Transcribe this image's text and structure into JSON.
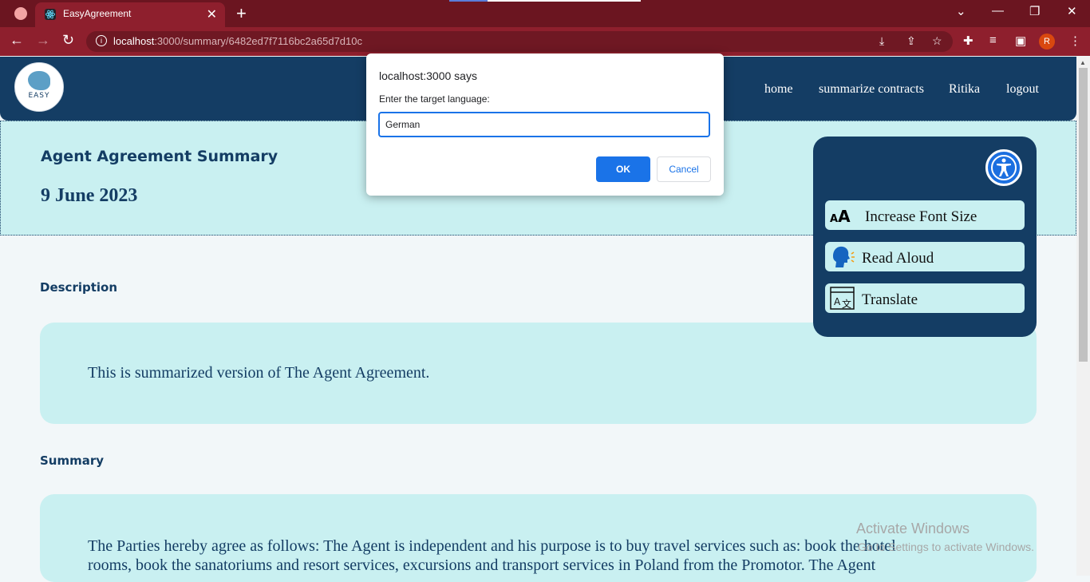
{
  "browser": {
    "tab_title": "EasyAgreement",
    "tab_close": "✕",
    "new_tab": "+",
    "url_host": "localhost",
    "url_rest": ":3000/summary/6482ed7f7116bc2a65d7d10c",
    "profile_initial": "R",
    "window_controls": [
      "⌄",
      "—",
      "❐",
      "✕"
    ]
  },
  "site": {
    "logo_text": "EASY",
    "nav": [
      "home",
      "summarize contracts",
      "Ritika",
      "logout"
    ]
  },
  "banner": {
    "title": "Agent Agreement Summary",
    "date": "9 June 2023"
  },
  "description": {
    "label": "Description",
    "text": "This is summarized version of The Agent Agreement."
  },
  "summary": {
    "label": "Summary",
    "line1": "The Parties hereby agree as follows: The Agent is independent and his purpose is to buy travel services such as: book the hotel",
    "line2": "rooms, book the sanatoriums and resort services, excursions and transport services in Poland from the Promotor. The Agent"
  },
  "accessibility": {
    "icon": "accessibility-icon",
    "buttons": [
      {
        "label": "Increase Font Size",
        "icon": "font-size-icon"
      },
      {
        "label": "Read Aloud",
        "icon": "speaking-head-icon"
      },
      {
        "label": "Translate",
        "icon": "translate-icon"
      }
    ]
  },
  "dialog": {
    "title": "localhost:3000 says",
    "message": "Enter the target language:",
    "input_value": "German",
    "ok_label": "OK",
    "cancel_label": "Cancel"
  },
  "watermark": {
    "line1": "Activate Windows",
    "line2": "Go to Settings to activate Windows."
  },
  "colors": {
    "header": "#143d64",
    "card": "#c9f0f1",
    "browser_frame": "#8e1f2d",
    "dialog_accent": "#1a73e8"
  }
}
